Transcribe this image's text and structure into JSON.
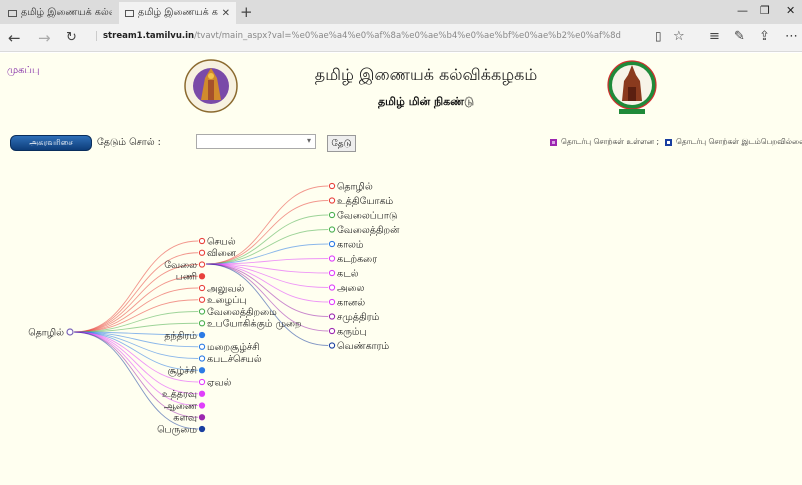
{
  "browser": {
    "tabs": [
      {
        "title": "தமிழ் இணையக் கல்வ",
        "active": false
      },
      {
        "title": "தமிழ் இணையக் கல",
        "active": true
      }
    ],
    "url_host": "stream1.tamilvu.in",
    "url_path": "/tvavt/main_aspx?val=%e0%ae%a4%e0%af%8a%e0%ae%b4%e0%ae%bf%e0%ae%b2%e0%af%8d"
  },
  "page": {
    "home_link": "முகப்பு",
    "title": "தமிழ் இணையக் கல்விக்கழகம்",
    "subtitle": "தமிழ் மின் நிகண்டு",
    "dictionary_button": "அகரவரிசை",
    "search_label": "தேடும் சொல் :",
    "search_value": "",
    "search_button": "தேடு",
    "legend_related_yes": "தொடர்பு சொற்கள் உள்ளன ;",
    "legend_related_no": "தொடர்பு சொற்கள் இடம்பெறவில்லை"
  },
  "colors": {
    "open_node_red": "#e8413c",
    "open_node_blue": "#2c7be5",
    "purple": "#9c27b0",
    "magenta": "#e040fb",
    "navy": "#1a3fa0"
  },
  "tree": {
    "root": "தொழில்",
    "level1": [
      {
        "label": "செயல்",
        "style": "open",
        "color": "#e8413c"
      },
      {
        "label": "வினை",
        "style": "open",
        "color": "#e8413c"
      },
      {
        "label": "வேலை",
        "style": "open",
        "color": "#e8413c"
      },
      {
        "label": "பணி",
        "style": "filled",
        "color": "#e8413c"
      },
      {
        "label": "அலுவல்",
        "style": "open",
        "color": "#e8413c"
      },
      {
        "label": "உழைப்பு",
        "style": "open",
        "color": "#e8413c"
      },
      {
        "label": "வேலைத்திறமை",
        "style": "open",
        "color": "#4caf50"
      },
      {
        "label": "உபயோகிக்கும் முறை",
        "style": "open",
        "color": "#4caf50"
      },
      {
        "label": "தந்திரம்",
        "style": "filled",
        "color": "#2c7be5"
      },
      {
        "label": "மறைசூழ்ச்சி",
        "style": "open",
        "color": "#2c7be5"
      },
      {
        "label": "கபடச்செயல்",
        "style": "open",
        "color": "#2c7be5"
      },
      {
        "label": "சூழ்ச்சி",
        "style": "filled",
        "color": "#2c7be5"
      },
      {
        "label": "ஏவல்",
        "style": "open",
        "color": "#e040fb"
      },
      {
        "label": "உத்தரவு",
        "style": "filled",
        "color": "#e040fb"
      },
      {
        "label": "ஆணை",
        "style": "filled",
        "color": "#e040fb"
      },
      {
        "label": "களவு",
        "style": "filled",
        "color": "#9c27b0"
      },
      {
        "label": "பெருமை",
        "style": "filled",
        "color": "#1a3fa0"
      }
    ],
    "level2": [
      {
        "label": "தொழில்",
        "color": "#e8413c"
      },
      {
        "label": "உத்தியோகம்",
        "color": "#e8413c"
      },
      {
        "label": "வேலைப்பாடு",
        "color": "#4caf50"
      },
      {
        "label": "வேலைத்திறன்",
        "color": "#4caf50"
      },
      {
        "label": "காலம்",
        "color": "#2c7be5"
      },
      {
        "label": "கடற்கரை",
        "color": "#e040fb"
      },
      {
        "label": "கடல்",
        "color": "#e040fb"
      },
      {
        "label": "அலை",
        "color": "#e040fb"
      },
      {
        "label": "கானல்",
        "color": "#e040fb"
      },
      {
        "label": "சமுத்திரம்",
        "color": "#9c27b0"
      },
      {
        "label": "கரும்பு",
        "color": "#9c27b0"
      },
      {
        "label": "வெண்காரம்",
        "color": "#1a3fa0"
      }
    ]
  }
}
